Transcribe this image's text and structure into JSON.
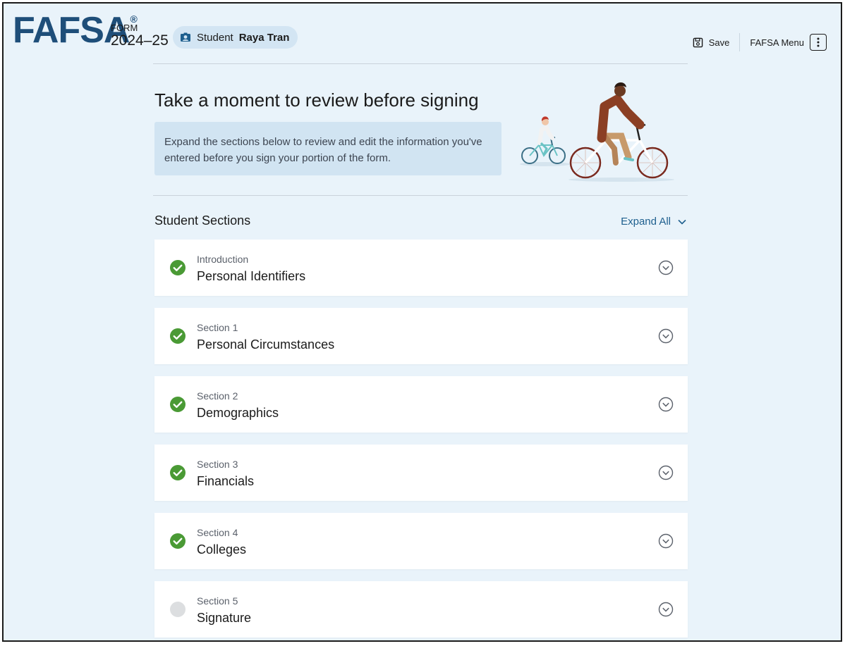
{
  "header": {
    "logo": "FAFSA",
    "logo_mark": "®",
    "form_label": "FORM",
    "form_year": "2024–25",
    "student_role": "Student",
    "student_name": "Raya Tran",
    "save_label": "Save",
    "menu_label": "FAFSA Menu",
    "icons": {
      "student": "student-id-icon",
      "save": "save-disk-icon",
      "menu": "kebab-menu-icon"
    }
  },
  "hero": {
    "title": "Take a moment to review before signing",
    "info": "Expand the sections below to review and edit the information you've entered before you sign your portion of the form."
  },
  "sections": {
    "heading": "Student Sections",
    "expand_all": "Expand All",
    "items": [
      {
        "label": "Introduction",
        "title": "Personal Identifiers",
        "complete": true
      },
      {
        "label": "Section 1",
        "title": "Personal Circumstances",
        "complete": true
      },
      {
        "label": "Section 2",
        "title": "Demographics",
        "complete": true
      },
      {
        "label": "Section 3",
        "title": "Financials",
        "complete": true
      },
      {
        "label": "Section 4",
        "title": "Colleges",
        "complete": true
      },
      {
        "label": "Section 5",
        "title": "Signature",
        "complete": false
      }
    ]
  },
  "colors": {
    "background": "#e9f3fa",
    "brand": "#1e4e79",
    "link": "#1e5f8e",
    "complete": "#4a9a35",
    "incomplete": "#dcdee0"
  }
}
